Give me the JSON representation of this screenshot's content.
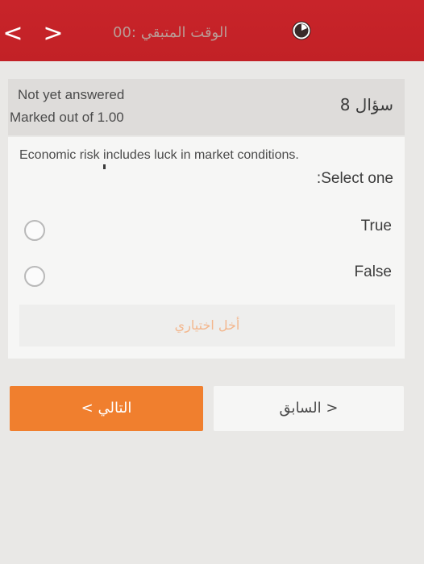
{
  "header": {
    "back_arrow": "<",
    "forward_arrow": ">",
    "timer_label": "الوقت المتبقي :00",
    "timer_icon": "clock-icon",
    "bar_color": "#c8242a"
  },
  "question_info": {
    "status": "Not yet answered",
    "marks": "Marked out of 1.00",
    "number_label": "سؤال 8"
  },
  "question": {
    "text": "Economic risk includes luck in market conditions.",
    "instruction": ":Select one",
    "options": [
      {
        "label": "True",
        "selected": false
      },
      {
        "label": "False",
        "selected": false
      }
    ],
    "clear_label": "أخل اختياري"
  },
  "navigation": {
    "next_label": "التالي",
    "next_chevron": "<",
    "prev_label": "السابق",
    "prev_chevron": ">",
    "accent_color": "#f07f2e"
  }
}
